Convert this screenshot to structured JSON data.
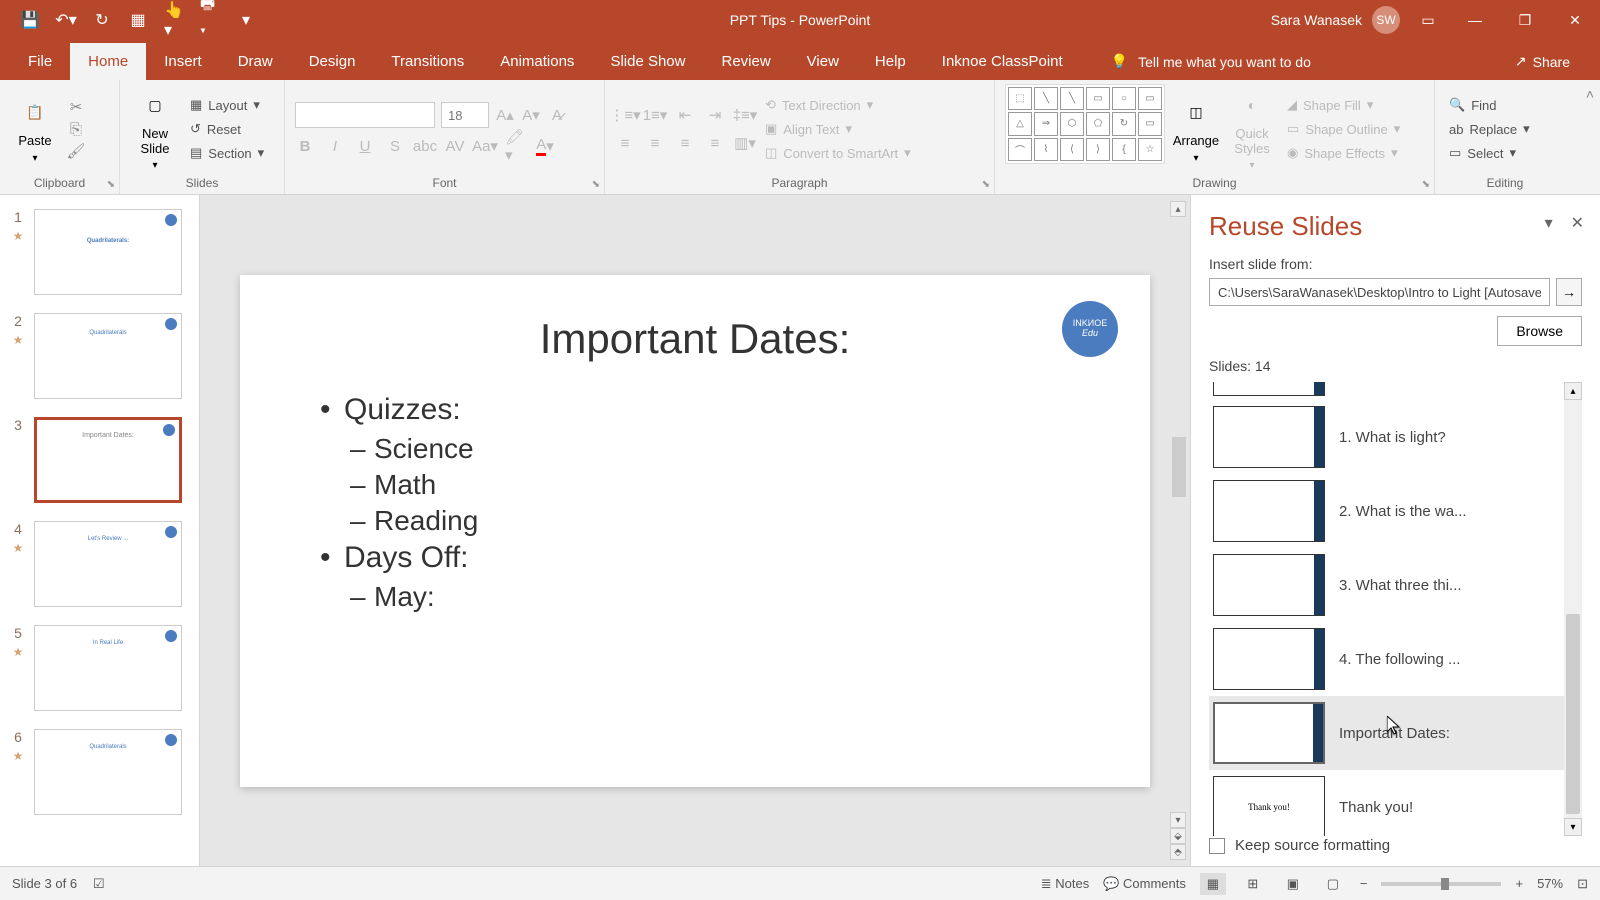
{
  "titlebar": {
    "title": "PPT Tips  -  PowerPoint",
    "user_name": "Sara Wanasek",
    "user_initials": "SW"
  },
  "tabs": {
    "items": [
      "File",
      "Home",
      "Insert",
      "Draw",
      "Design",
      "Transitions",
      "Animations",
      "Slide Show",
      "Review",
      "View",
      "Help",
      "Inknoe ClassPoint"
    ],
    "tell_me": "Tell me what you want to do",
    "share": "Share"
  },
  "ribbon": {
    "clipboard": {
      "label": "Clipboard",
      "paste": "Paste"
    },
    "slides": {
      "label": "Slides",
      "new_slide": "New\nSlide",
      "layout": "Layout",
      "reset": "Reset",
      "section": "Section"
    },
    "font": {
      "label": "Font",
      "size": "18"
    },
    "paragraph": {
      "label": "Paragraph",
      "text_direction": "Text Direction",
      "align_text": "Align Text",
      "convert_smartart": "Convert to SmartArt"
    },
    "drawing": {
      "label": "Drawing",
      "arrange": "Arrange",
      "quick_styles": "Quick\nStyles",
      "shape_fill": "Shape Fill",
      "shape_outline": "Shape Outline",
      "shape_effects": "Shape Effects"
    },
    "editing": {
      "label": "Editing",
      "find": "Find",
      "replace": "Replace",
      "select": "Select"
    }
  },
  "slide": {
    "title": "Important Dates:",
    "items": {
      "quizzes": "Quizzes:",
      "science": "Science",
      "math": "Math",
      "reading": "Reading",
      "days_off": "Days Off:",
      "may": "May:"
    },
    "badge": {
      "line1": "INKИOE",
      "line2": "Edu"
    }
  },
  "thumbs": {
    "t1": "Quadrilaterals:",
    "t2": "Quadrilaterals",
    "t3": "Important Dates:",
    "t4": "Let's Review ...",
    "t5": "In Real Life",
    "t6": "Quadrilaterals"
  },
  "reuse": {
    "title": "Reuse Slides",
    "insert_from": "Insert slide from:",
    "path": "C:\\Users\\SaraWanasek\\Desktop\\Intro to Light [Autosaved].",
    "browse": "Browse",
    "count": "Slides: 14",
    "items": [
      {
        "label": "1. What is light?"
      },
      {
        "label": "2. What is the wa..."
      },
      {
        "label": "3. What three thi..."
      },
      {
        "label": "4. The following ..."
      },
      {
        "label": "Important Dates:"
      },
      {
        "label": "Thank you!"
      }
    ],
    "keep_formatting": "Keep source formatting"
  },
  "statusbar": {
    "slide_info": "Slide 3 of 6",
    "notes": "Notes",
    "comments": "Comments",
    "zoom": "57%"
  }
}
